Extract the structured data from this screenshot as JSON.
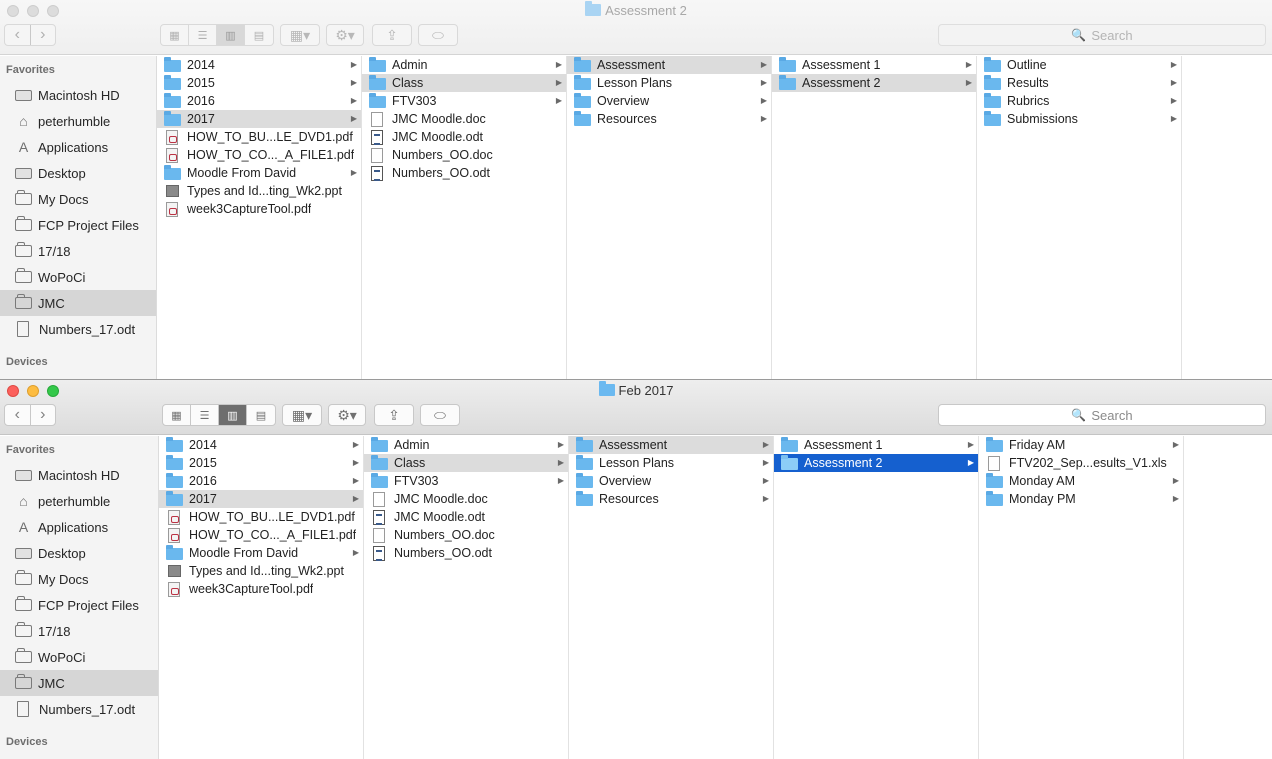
{
  "windows": [
    {
      "title": "Assessment 2",
      "search_placeholder": "Search",
      "sidebar": {
        "favorites_header": "Favorites",
        "devices_header": "Devices",
        "items": [
          {
            "label": "Macintosh HD",
            "icon": "hard-drive-icon"
          },
          {
            "label": "peterhumble",
            "icon": "home-icon"
          },
          {
            "label": "Applications",
            "icon": "applications-icon"
          },
          {
            "label": "Desktop",
            "icon": "desktop-icon"
          },
          {
            "label": "My Docs",
            "icon": "folder-icon"
          },
          {
            "label": "FCP Project Files",
            "icon": "folder-icon"
          },
          {
            "label": "17/18",
            "icon": "folder-icon"
          },
          {
            "label": "WoPoCi",
            "icon": "folder-icon"
          },
          {
            "label": "JMC",
            "icon": "folder-icon",
            "selected": true
          },
          {
            "label": "Numbers_17.odt",
            "icon": "document-icon"
          }
        ]
      },
      "columns": [
        [
          {
            "name": "2014",
            "type": "folder",
            "arrow": true
          },
          {
            "name": "2015",
            "type": "folder",
            "arrow": true
          },
          {
            "name": "2016",
            "type": "folder",
            "arrow": true
          },
          {
            "name": "2017",
            "type": "folder",
            "arrow": true,
            "selected": "gray"
          },
          {
            "name": "HOW_TO_BU...LE_DVD1.pdf",
            "type": "pdf"
          },
          {
            "name": "HOW_TO_CO..._A_FILE1.pdf",
            "type": "pdf"
          },
          {
            "name": "Moodle From David",
            "type": "folder",
            "arrow": true
          },
          {
            "name": "Types and Id...ting_Wk2.ppt",
            "type": "ppt"
          },
          {
            "name": "week3CaptureTool.pdf",
            "type": "pdf"
          }
        ],
        [
          {
            "name": "Admin",
            "type": "folder",
            "arrow": true
          },
          {
            "name": "Class",
            "type": "folder",
            "arrow": true,
            "selected": "gray"
          },
          {
            "name": "FTV303",
            "type": "folder",
            "arrow": true
          },
          {
            "name": "JMC Moodle.doc",
            "type": "doc"
          },
          {
            "name": "JMC Moodle.odt",
            "type": "odt"
          },
          {
            "name": "Numbers_OO.doc",
            "type": "doc"
          },
          {
            "name": "Numbers_OO.odt",
            "type": "odt"
          }
        ],
        [
          {
            "name": "Assessment",
            "type": "folder",
            "arrow": true,
            "selected": "gray"
          },
          {
            "name": "Lesson Plans",
            "type": "folder",
            "arrow": true
          },
          {
            "name": "Overview",
            "type": "folder",
            "arrow": true
          },
          {
            "name": "Resources",
            "type": "folder",
            "arrow": true
          }
        ],
        [
          {
            "name": "Assessment 1",
            "type": "folder",
            "arrow": true
          },
          {
            "name": "Assessment 2",
            "type": "folder",
            "arrow": true,
            "selected": "gray"
          }
        ],
        [
          {
            "name": "Outline",
            "type": "folder",
            "arrow": true
          },
          {
            "name": "Results",
            "type": "folder",
            "arrow": true
          },
          {
            "name": "Rubrics",
            "type": "folder",
            "arrow": true
          },
          {
            "name": "Submissions",
            "type": "folder",
            "arrow": true
          }
        ],
        []
      ]
    },
    {
      "title": "Feb 2017",
      "search_placeholder": "Search",
      "sidebar": {
        "favorites_header": "Favorites",
        "devices_header": "Devices",
        "items": [
          {
            "label": "Macintosh HD",
            "icon": "hard-drive-icon"
          },
          {
            "label": "peterhumble",
            "icon": "home-icon"
          },
          {
            "label": "Applications",
            "icon": "applications-icon"
          },
          {
            "label": "Desktop",
            "icon": "desktop-icon"
          },
          {
            "label": "My Docs",
            "icon": "folder-icon"
          },
          {
            "label": "FCP Project Files",
            "icon": "folder-icon"
          },
          {
            "label": "17/18",
            "icon": "folder-icon"
          },
          {
            "label": "WoPoCi",
            "icon": "folder-icon"
          },
          {
            "label": "JMC",
            "icon": "folder-icon",
            "selected": true
          },
          {
            "label": "Numbers_17.odt",
            "icon": "document-icon"
          }
        ]
      },
      "columns": [
        [
          {
            "name": "2014",
            "type": "folder",
            "arrow": true
          },
          {
            "name": "2015",
            "type": "folder",
            "arrow": true
          },
          {
            "name": "2016",
            "type": "folder",
            "arrow": true
          },
          {
            "name": "2017",
            "type": "folder",
            "arrow": true,
            "selected": "gray"
          },
          {
            "name": "HOW_TO_BU...LE_DVD1.pdf",
            "type": "pdf"
          },
          {
            "name": "HOW_TO_CO..._A_FILE1.pdf",
            "type": "pdf"
          },
          {
            "name": "Moodle From David",
            "type": "folder",
            "arrow": true
          },
          {
            "name": "Types and Id...ting_Wk2.ppt",
            "type": "ppt"
          },
          {
            "name": "week3CaptureTool.pdf",
            "type": "pdf"
          }
        ],
        [
          {
            "name": "Admin",
            "type": "folder",
            "arrow": true
          },
          {
            "name": "Class",
            "type": "folder",
            "arrow": true,
            "selected": "gray"
          },
          {
            "name": "FTV303",
            "type": "folder",
            "arrow": true
          },
          {
            "name": "JMC Moodle.doc",
            "type": "doc"
          },
          {
            "name": "JMC Moodle.odt",
            "type": "odt"
          },
          {
            "name": "Numbers_OO.doc",
            "type": "doc"
          },
          {
            "name": "Numbers_OO.odt",
            "type": "odt"
          }
        ],
        [
          {
            "name": "Assessment",
            "type": "folder",
            "arrow": true,
            "selected": "gray"
          },
          {
            "name": "Lesson Plans",
            "type": "folder",
            "arrow": true
          },
          {
            "name": "Overview",
            "type": "folder",
            "arrow": true
          },
          {
            "name": "Resources",
            "type": "folder",
            "arrow": true
          }
        ],
        [
          {
            "name": "Assessment 1",
            "type": "folder",
            "arrow": true
          },
          {
            "name": "Assessment 2",
            "type": "folder",
            "arrow": true,
            "selected": "blue"
          }
        ],
        [
          {
            "name": "Friday AM",
            "type": "folder",
            "arrow": true
          },
          {
            "name": "FTV202_Sep...esults_V1.xls",
            "type": "doc"
          },
          {
            "name": "Monday AM",
            "type": "folder",
            "arrow": true
          },
          {
            "name": "Monday PM",
            "type": "folder",
            "arrow": true
          }
        ],
        []
      ]
    }
  ],
  "colors": {
    "selection_blue": "#1560cf",
    "selection_gray": "#dcdcdc",
    "folder_blue": "#6ab8ee"
  }
}
